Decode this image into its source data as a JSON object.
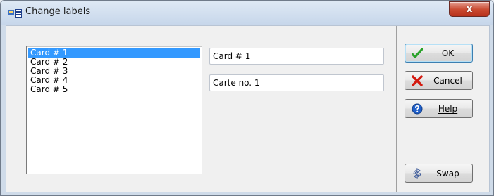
{
  "window": {
    "title": "Change labels",
    "close_glyph": "x",
    "close_color": "#c9482f"
  },
  "list": {
    "items": [
      "Card # 1",
      "Card # 2",
      "Card # 3",
      "Card # 4",
      "Card # 5"
    ],
    "selected_index": 0
  },
  "fields": {
    "label_value": "Card # 1",
    "alt_label_value": "Carte no. 1"
  },
  "buttons": {
    "ok": {
      "label": "OK",
      "icon": "checkmark-icon"
    },
    "cancel": {
      "label": "Cancel",
      "icon": "x-cross-icon"
    },
    "help": {
      "label": "Help",
      "icon": "help-icon"
    },
    "swap": {
      "label": "Swap",
      "icon": "swap-arrows-icon"
    }
  },
  "colors": {
    "selection": "#3399ff",
    "ok_green": "#2aa22a",
    "cancel_red": "#d3190f",
    "help_blue": "#1f5fc9"
  }
}
